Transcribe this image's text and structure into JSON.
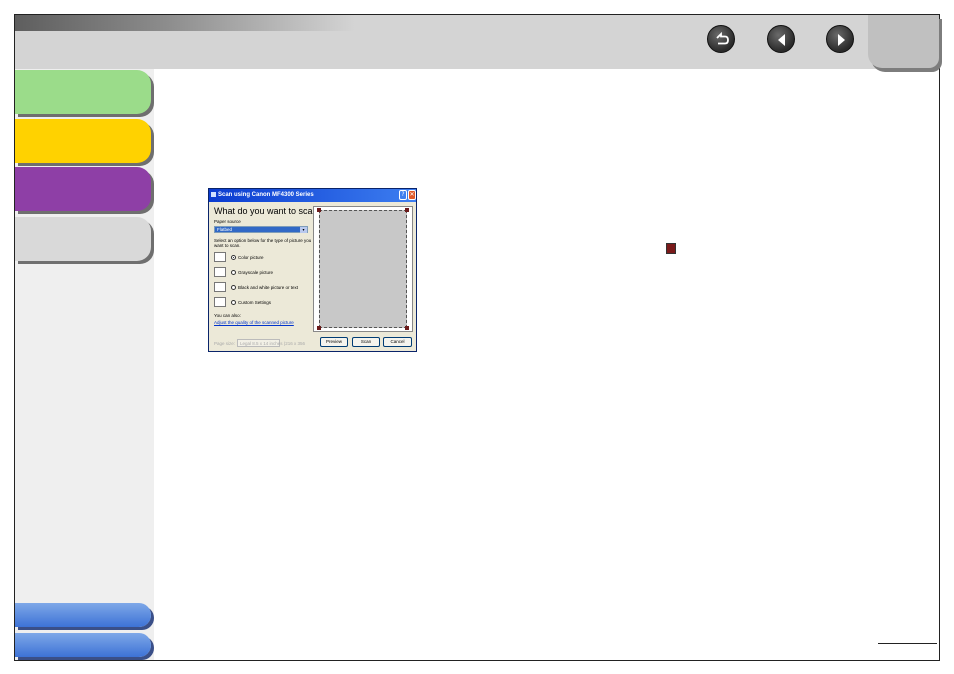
{
  "nav": {
    "back_icon": "back-arrow-icon",
    "prev_icon": "previous-page-icon",
    "next_icon": "next-page-icon"
  },
  "sidebar": {
    "tabs": [
      {
        "color": "#9bdc8a"
      },
      {
        "color": "#ffd200"
      },
      {
        "color": "#8e3fa6"
      },
      {
        "color": "#d9d9d9"
      }
    ],
    "bottom_tabs_color": "#3d72d6"
  },
  "dialog": {
    "title": "Scan using Canon MF4300 Series",
    "heading": "What do you want to scan?",
    "paper_source_label": "Paper source",
    "paper_source_value": "Flatbed",
    "instruction_line1": "Select an option below for the type of picture you",
    "instruction_line2": "want to scan.",
    "options": [
      {
        "label": "Color picture",
        "selected": true,
        "icon": "color-picture-icon"
      },
      {
        "label": "Grayscale picture",
        "selected": false,
        "icon": "grayscale-picture-icon"
      },
      {
        "label": "Black and white picture or text",
        "selected": false,
        "icon": "black-white-picture-icon"
      },
      {
        "label": "Custom Settings",
        "selected": false,
        "icon": "custom-settings-icon"
      }
    ],
    "also_label": "You can also:",
    "link_text": "Adjust the quality of the scanned picture",
    "pages_label": "Page size:",
    "pages_value": "Legal 8.5 x 14 inches (216 x 356",
    "buttons": {
      "preview": "Preview",
      "scan": "Scan",
      "cancel": "Cancel"
    },
    "help_glyph": "?",
    "close_glyph": "✕"
  }
}
